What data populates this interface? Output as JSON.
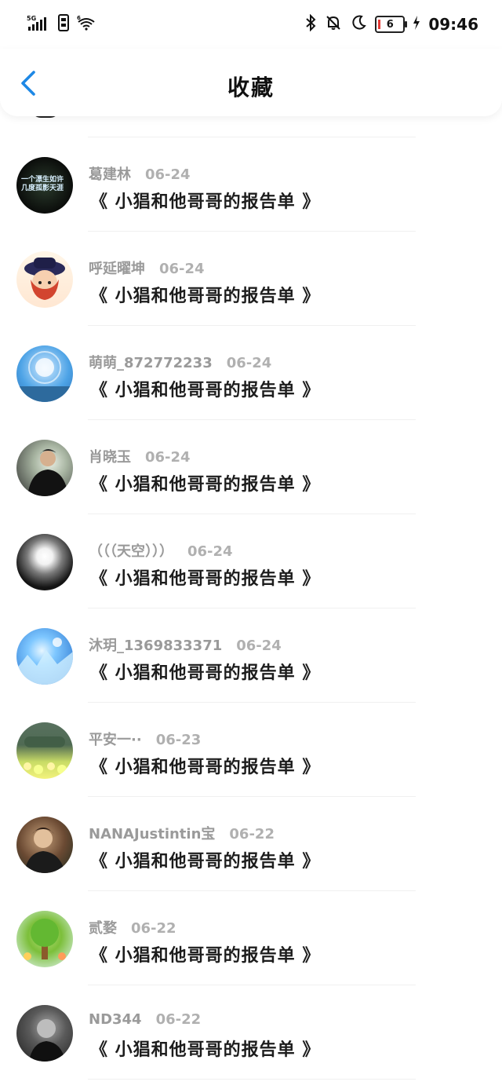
{
  "status_bar": {
    "network": "5G",
    "wifi_tag": "6",
    "battery_level": "6",
    "time": "09:46"
  },
  "header": {
    "title": "收藏"
  },
  "favorites": [
    {
      "name": "葛建林",
      "date": "06-24",
      "title": "《 小猖和他哥哥的报告单 》"
    },
    {
      "name": "呼延曜坤",
      "date": "06-24",
      "title": "《 小猖和他哥哥的报告单 》"
    },
    {
      "name": "萌萌_872772233",
      "date": "06-24",
      "title": "《 小猖和他哥哥的报告单 》"
    },
    {
      "name": "肖晓玉",
      "date": "06-24",
      "title": "《 小猖和他哥哥的报告单 》"
    },
    {
      "name": "（（（天空）））",
      "date": "06-24",
      "title": "《 小猖和他哥哥的报告单 》"
    },
    {
      "name": "沐玥_1369833371",
      "date": "06-24",
      "title": "《 小猖和他哥哥的报告单 》"
    },
    {
      "name": "平安一··",
      "date": "06-23",
      "title": "《 小猖和他哥哥的报告单 》"
    },
    {
      "name": "NANAJustintin宝",
      "date": "06-22",
      "title": "《 小猖和他哥哥的报告单 》"
    },
    {
      "name": "贰婺",
      "date": "06-22",
      "title": "《 小猖和他哥哥的报告单 》"
    },
    {
      "name": "ND344",
      "date": "06-22",
      "title": "《 小猖和他哥哥的报告单 》"
    }
  ],
  "avatar1_text": "一个漂生如许\n几度孤影天涯"
}
